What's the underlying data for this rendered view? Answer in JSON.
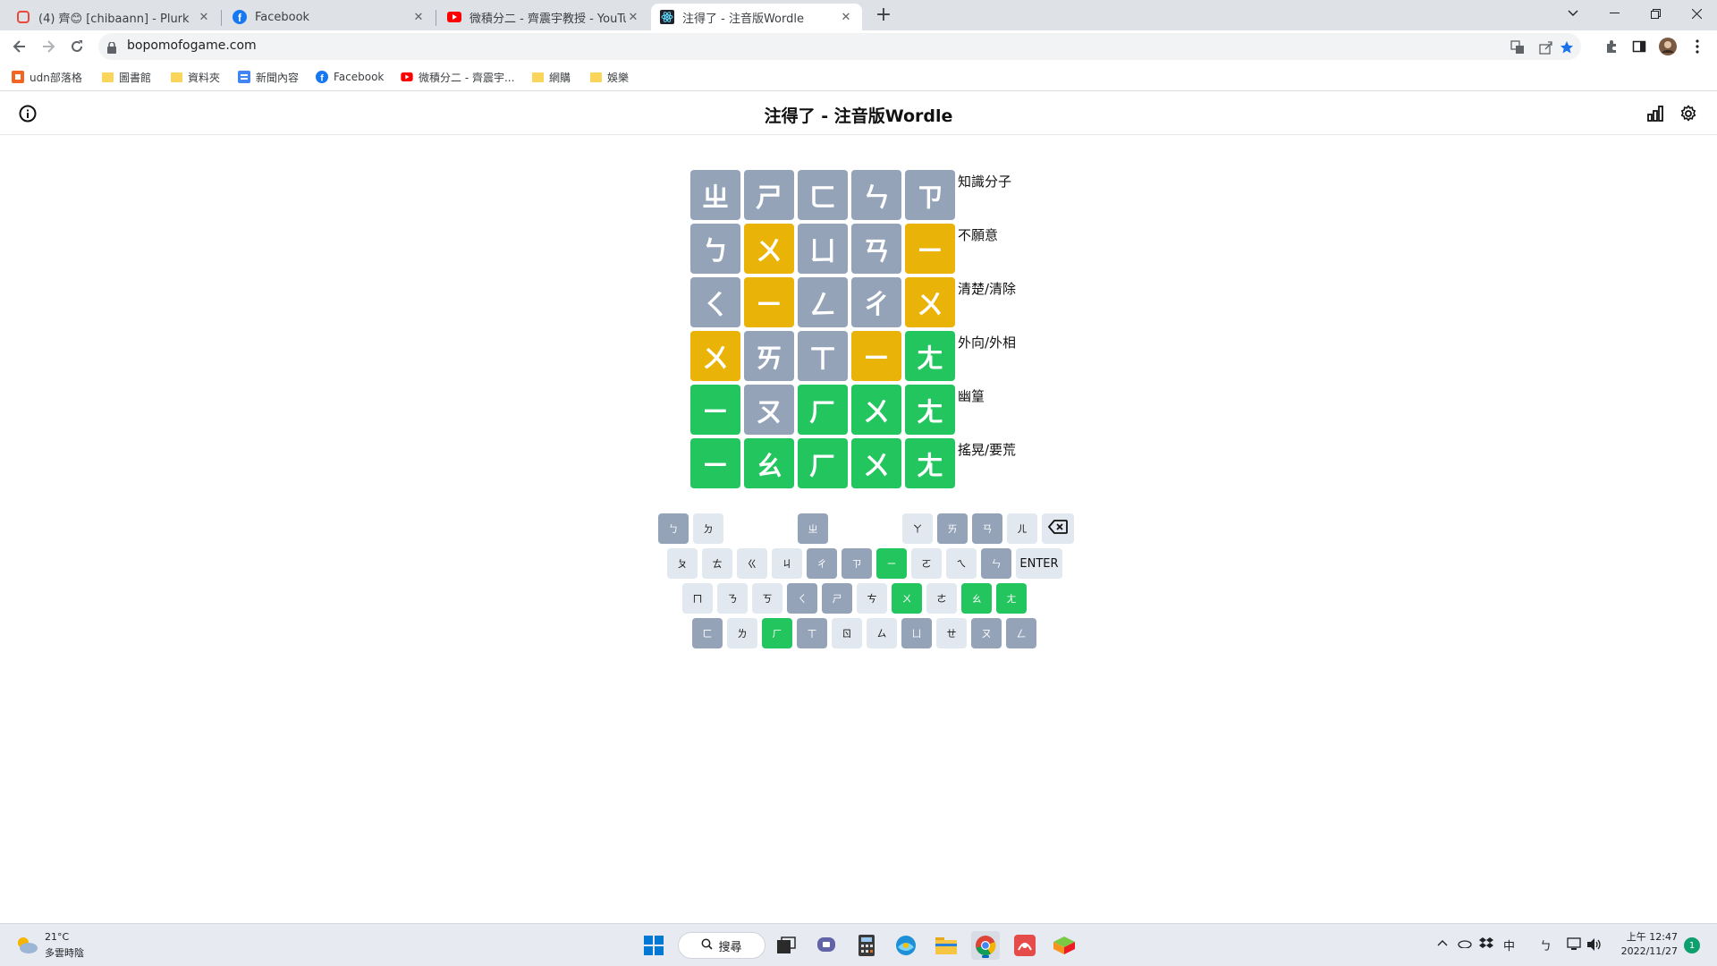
{
  "browser": {
    "tabs": [
      {
        "title": "(4) 齊😊 [chibaann] - Plurk",
        "icon": "plurk-icon",
        "active": false
      },
      {
        "title": "Facebook",
        "icon": "facebook-icon",
        "active": false
      },
      {
        "title": "微積分二 - 齊震宇教授 - YouTube",
        "icon": "youtube-icon",
        "active": false
      },
      {
        "title": "注得了 - 注音版Wordle",
        "icon": "react-icon",
        "active": true
      }
    ],
    "url": "bopomofogame.com",
    "bookmarks": [
      {
        "label": "udn部落格",
        "icon": "udn-icon"
      },
      {
        "label": "圖書館",
        "icon": "folder-icon"
      },
      {
        "label": "資料夾",
        "icon": "folder-icon"
      },
      {
        "label": "新聞內容",
        "icon": "news-icon"
      },
      {
        "label": "Facebook",
        "icon": "facebook-icon"
      },
      {
        "label": "微積分二 - 齊震宇...",
        "icon": "youtube-icon"
      },
      {
        "label": "網購",
        "icon": "folder-icon"
      },
      {
        "label": "娛樂",
        "icon": "folder-icon"
      }
    ],
    "colors": {
      "tabstrip": "#dee1e6",
      "facebook": "#1877f2",
      "youtube": "#ff0000",
      "star": "#1a73e8"
    }
  },
  "page": {
    "title": "注得了 - 注音版Wordle"
  },
  "board": {
    "rows": [
      {
        "hint": "知識分子",
        "tiles": [
          {
            "char": "ㄓ",
            "state": "absent"
          },
          {
            "char": "ㄕ",
            "state": "absent"
          },
          {
            "char": "ㄈ",
            "state": "absent"
          },
          {
            "char": "ㄣ",
            "state": "absent"
          },
          {
            "char": "ㄗ",
            "state": "absent"
          }
        ]
      },
      {
        "hint": "不願意",
        "tiles": [
          {
            "char": "ㄅ",
            "state": "absent"
          },
          {
            "char": "ㄨ",
            "state": "present"
          },
          {
            "char": "ㄩ",
            "state": "absent"
          },
          {
            "char": "ㄢ",
            "state": "absent"
          },
          {
            "char": "ㄧ",
            "state": "present"
          }
        ]
      },
      {
        "hint": "清楚/清除",
        "tiles": [
          {
            "char": "ㄑ",
            "state": "absent"
          },
          {
            "char": "ㄧ",
            "state": "present"
          },
          {
            "char": "ㄥ",
            "state": "absent"
          },
          {
            "char": "ㄔ",
            "state": "absent"
          },
          {
            "char": "ㄨ",
            "state": "present"
          }
        ]
      },
      {
        "hint": "外向/外相",
        "tiles": [
          {
            "char": "ㄨ",
            "state": "present"
          },
          {
            "char": "ㄞ",
            "state": "absent"
          },
          {
            "char": "ㄒ",
            "state": "absent"
          },
          {
            "char": "ㄧ",
            "state": "present"
          },
          {
            "char": "ㄤ",
            "state": "correct"
          }
        ]
      },
      {
        "hint": "幽篁",
        "tiles": [
          {
            "char": "ㄧ",
            "state": "correct"
          },
          {
            "char": "ㄡ",
            "state": "absent"
          },
          {
            "char": "ㄏ",
            "state": "correct"
          },
          {
            "char": "ㄨ",
            "state": "correct"
          },
          {
            "char": "ㄤ",
            "state": "correct"
          }
        ]
      },
      {
        "hint": "搖晃/要荒",
        "tiles": [
          {
            "char": "ㄧ",
            "state": "correct"
          },
          {
            "char": "ㄠ",
            "state": "correct"
          },
          {
            "char": "ㄏ",
            "state": "correct"
          },
          {
            "char": "ㄨ",
            "state": "correct"
          },
          {
            "char": "ㄤ",
            "state": "correct"
          }
        ]
      }
    ],
    "colors": {
      "absent": "#94a3b8",
      "present": "#eab308",
      "correct": "#22c55e",
      "unused": "#e2e8f0"
    }
  },
  "keyboard": {
    "rows": [
      [
        {
          "label": "ㄅ",
          "state": "absent",
          "col": 0
        },
        {
          "label": "ㄉ",
          "state": "unused",
          "col": 1
        },
        {
          "label": "ㄓ",
          "state": "absent",
          "col": 4
        },
        {
          "label": "ㄚ",
          "state": "unused",
          "col": 7
        },
        {
          "label": "ㄞ",
          "state": "absent",
          "col": 8
        },
        {
          "label": "ㄢ",
          "state": "absent",
          "col": 9
        },
        {
          "label": "ㄦ",
          "state": "unused",
          "col": 10
        },
        {
          "label": "",
          "state": "backspace",
          "col": 11
        }
      ],
      [
        {
          "label": "ㄆ",
          "state": "unused",
          "col": 0
        },
        {
          "label": "ㄊ",
          "state": "unused",
          "col": 1
        },
        {
          "label": "ㄍ",
          "state": "unused",
          "col": 2
        },
        {
          "label": "ㄐ",
          "state": "unused",
          "col": 3
        },
        {
          "label": "ㄔ",
          "state": "absent",
          "col": 4
        },
        {
          "label": "ㄗ",
          "state": "absent",
          "col": 5
        },
        {
          "label": "ㄧ",
          "state": "correct",
          "col": 6
        },
        {
          "label": "ㄛ",
          "state": "unused",
          "col": 7
        },
        {
          "label": "ㄟ",
          "state": "unused",
          "col": 8
        },
        {
          "label": "ㄣ",
          "state": "absent",
          "col": 9
        },
        {
          "label": "ENTER",
          "state": "enter",
          "col": 10
        }
      ],
      [
        {
          "label": "ㄇ",
          "state": "unused",
          "col": 0
        },
        {
          "label": "ㄋ",
          "state": "unused",
          "col": 1
        },
        {
          "label": "ㄎ",
          "state": "unused",
          "col": 2
        },
        {
          "label": "ㄑ",
          "state": "absent",
          "col": 3
        },
        {
          "label": "ㄕ",
          "state": "absent",
          "col": 4
        },
        {
          "label": "ㄘ",
          "state": "unused",
          "col": 5
        },
        {
          "label": "ㄨ",
          "state": "correct",
          "col": 6
        },
        {
          "label": "ㄜ",
          "state": "unused",
          "col": 7
        },
        {
          "label": "ㄠ",
          "state": "correct",
          "col": 8
        },
        {
          "label": "ㄤ",
          "state": "correct",
          "col": 9
        }
      ],
      [
        {
          "label": "ㄈ",
          "state": "absent",
          "col": 0
        },
        {
          "label": "ㄌ",
          "state": "unused",
          "col": 1
        },
        {
          "label": "ㄏ",
          "state": "correct",
          "col": 2
        },
        {
          "label": "ㄒ",
          "state": "absent",
          "col": 3
        },
        {
          "label": "ㄖ",
          "state": "unused",
          "col": 4
        },
        {
          "label": "ㄙ",
          "state": "unused",
          "col": 5
        },
        {
          "label": "ㄩ",
          "state": "absent",
          "col": 6
        },
        {
          "label": "ㄝ",
          "state": "unused",
          "col": 7
        },
        {
          "label": "ㄡ",
          "state": "absent",
          "col": 8
        },
        {
          "label": "ㄥ",
          "state": "absent",
          "col": 9
        }
      ]
    ]
  },
  "taskbar": {
    "weather_temp": "21°C",
    "weather_desc": "多雲時陰",
    "search_label": "搜尋",
    "tray_ime": "中",
    "tray_ime2": "ㄅ",
    "time": "上午 12:47",
    "date": "2022/11/27",
    "notifications": "1"
  }
}
